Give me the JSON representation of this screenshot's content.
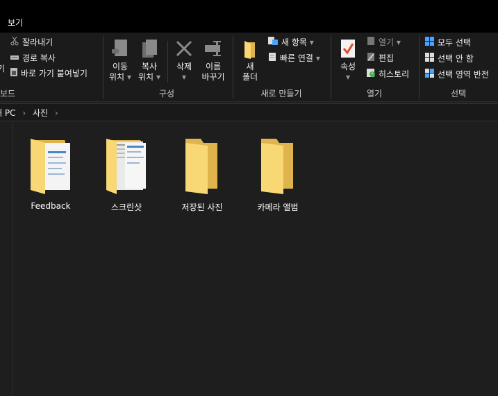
{
  "tab": {
    "view_label": "보기"
  },
  "clipboard": {
    "cut_label": "잘라내기",
    "copy_path_label": "경로 복사",
    "paste_shortcut_label": "바로 가기 붙여넣기",
    "cut_left_char": "기",
    "group_label": "보드"
  },
  "organize": {
    "move_to_line1": "이동",
    "move_to_line2": "위치",
    "copy_to_line1": "복사",
    "copy_to_line2": "위치",
    "delete_label": "삭제",
    "rename_line1": "이름",
    "rename_line2": "바꾸기",
    "group_label": "구성"
  },
  "new": {
    "new_folder_line1": "새",
    "new_folder_line2": "폴더",
    "new_item_label": "새 항목",
    "easy_access_label": "빠른 연결",
    "group_label": "새로 만들기"
  },
  "open": {
    "properties_label": "속성",
    "open_label": "열기",
    "edit_label": "편집",
    "history_label": "히스토리",
    "group_label": "열기"
  },
  "select": {
    "select_all_label": "모두 선택",
    "select_none_label": "선택 안 함",
    "invert_label": "선택 영역 반전",
    "group_label": "선택"
  },
  "address": {
    "pc_label": "내 PC",
    "folder_label": "사진"
  },
  "folders": [
    {
      "name": "Feedback",
      "icon": "folder-with-documents-icon"
    },
    {
      "name": "스크린샷",
      "icon": "folder-with-screenshots-icon"
    },
    {
      "name": "저장된 사진",
      "icon": "folder-icon"
    },
    {
      "name": "카메라 앨범",
      "icon": "folder-icon"
    }
  ],
  "colors": {
    "folder_yellow": "#f8d775",
    "folder_dark": "#e0b44c",
    "check_red": "#e04a2f",
    "select_blue": "#4aa3ff"
  }
}
